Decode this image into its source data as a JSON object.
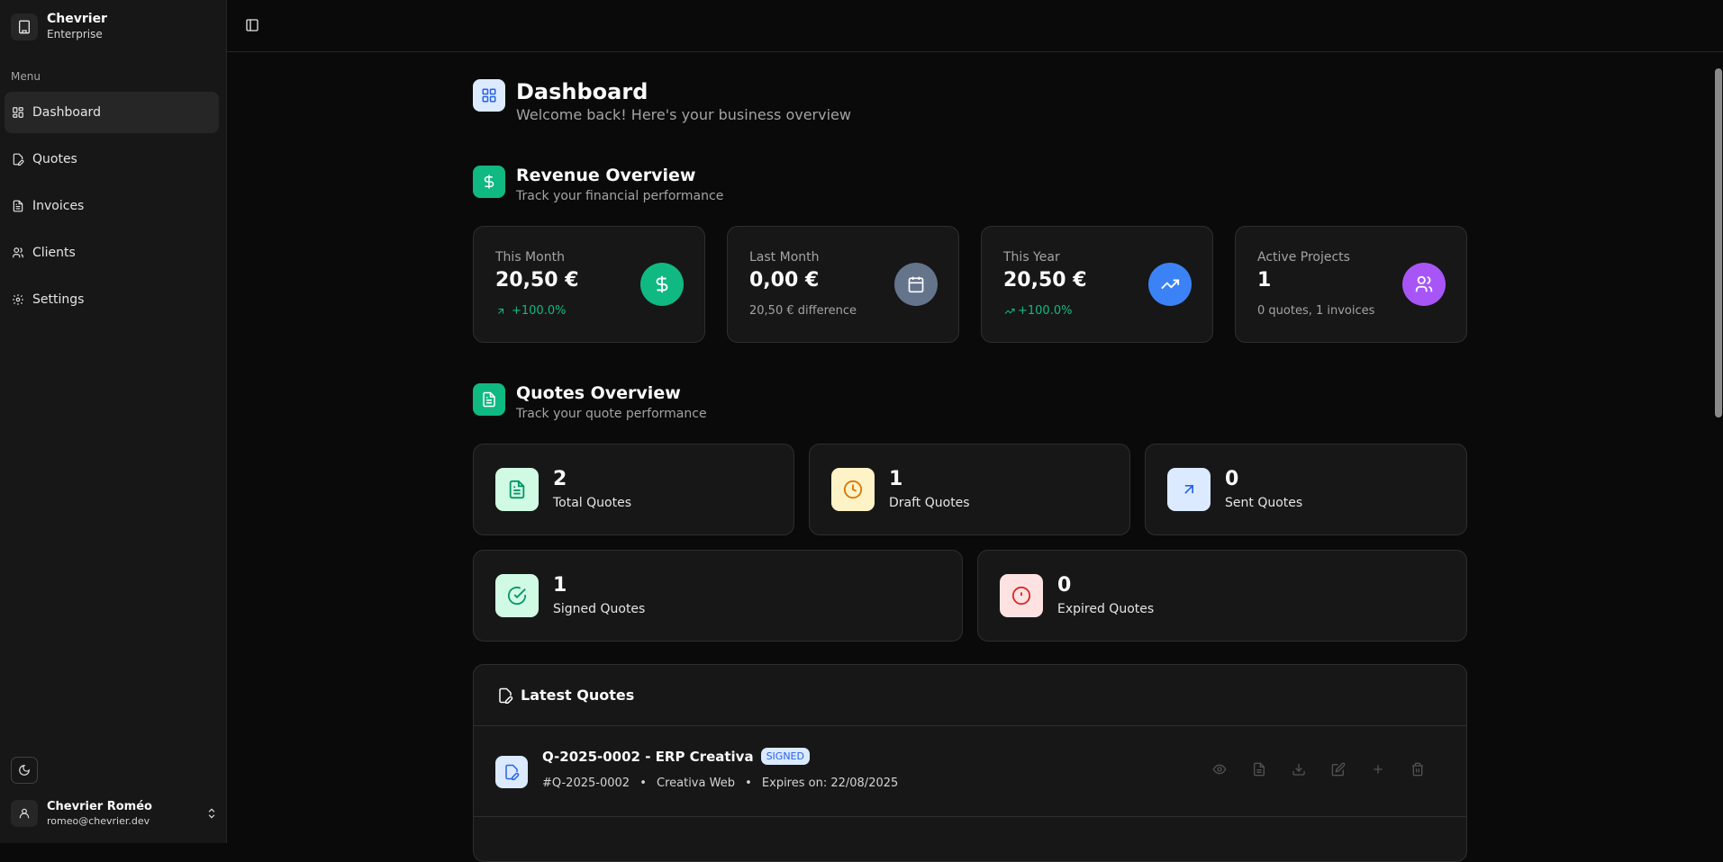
{
  "sidebar": {
    "brand_name": "Chevrier",
    "brand_sub": "Enterprise",
    "menu_label": "Menu",
    "items": [
      {
        "label": "Dashboard"
      },
      {
        "label": "Quotes"
      },
      {
        "label": "Invoices"
      },
      {
        "label": "Clients"
      },
      {
        "label": "Settings"
      }
    ],
    "user_name": "Chevrier Roméo",
    "user_email": "romeo@chevrier.dev"
  },
  "page": {
    "title": "Dashboard",
    "subtitle": "Welcome back! Here's your business overview"
  },
  "revenue": {
    "title": "Revenue Overview",
    "subtitle": "Track your financial performance",
    "cards": [
      {
        "label": "This Month",
        "value": "20,50 €",
        "foot": "+100.0%",
        "icon": "dollar-icon",
        "color": "#10b981"
      },
      {
        "label": "Last Month",
        "value": "0,00 €",
        "foot": "20,50 € difference",
        "icon": "calendar-icon",
        "color": "#64748b"
      },
      {
        "label": "This Year",
        "value": "20,50 €",
        "foot": "+100.0%",
        "icon": "trending-up-icon",
        "color": "#3b82f6"
      },
      {
        "label": "Active Projects",
        "value": "1",
        "foot": "0 quotes, 1 invoices",
        "icon": "users-icon",
        "color": "#a855f7"
      }
    ]
  },
  "quotes_overview": {
    "title": "Quotes Overview",
    "subtitle": "Track your quote performance",
    "cards": [
      {
        "value": "2",
        "label": "Total Quotes",
        "icon": "file-text-icon"
      },
      {
        "value": "1",
        "label": "Draft Quotes",
        "icon": "clock-icon"
      },
      {
        "value": "0",
        "label": "Sent Quotes",
        "icon": "arrow-up-right-icon"
      },
      {
        "value": "1",
        "label": "Signed Quotes",
        "icon": "check-circle-icon"
      },
      {
        "value": "0",
        "label": "Expired Quotes",
        "icon": "alert-circle-icon"
      }
    ]
  },
  "latest_quotes": {
    "title": "Latest Quotes",
    "rows": [
      {
        "title": "Q-2025-0002 - ERP Creativa",
        "status": "SIGNED",
        "number": "#Q-2025-0002",
        "client": "Creativa Web",
        "expires": "Expires on: 22/08/2025"
      }
    ]
  },
  "colors": {
    "accent_green": "#10b981",
    "accent_blue": "#3b82f6",
    "accent_purple": "#a855f7"
  }
}
